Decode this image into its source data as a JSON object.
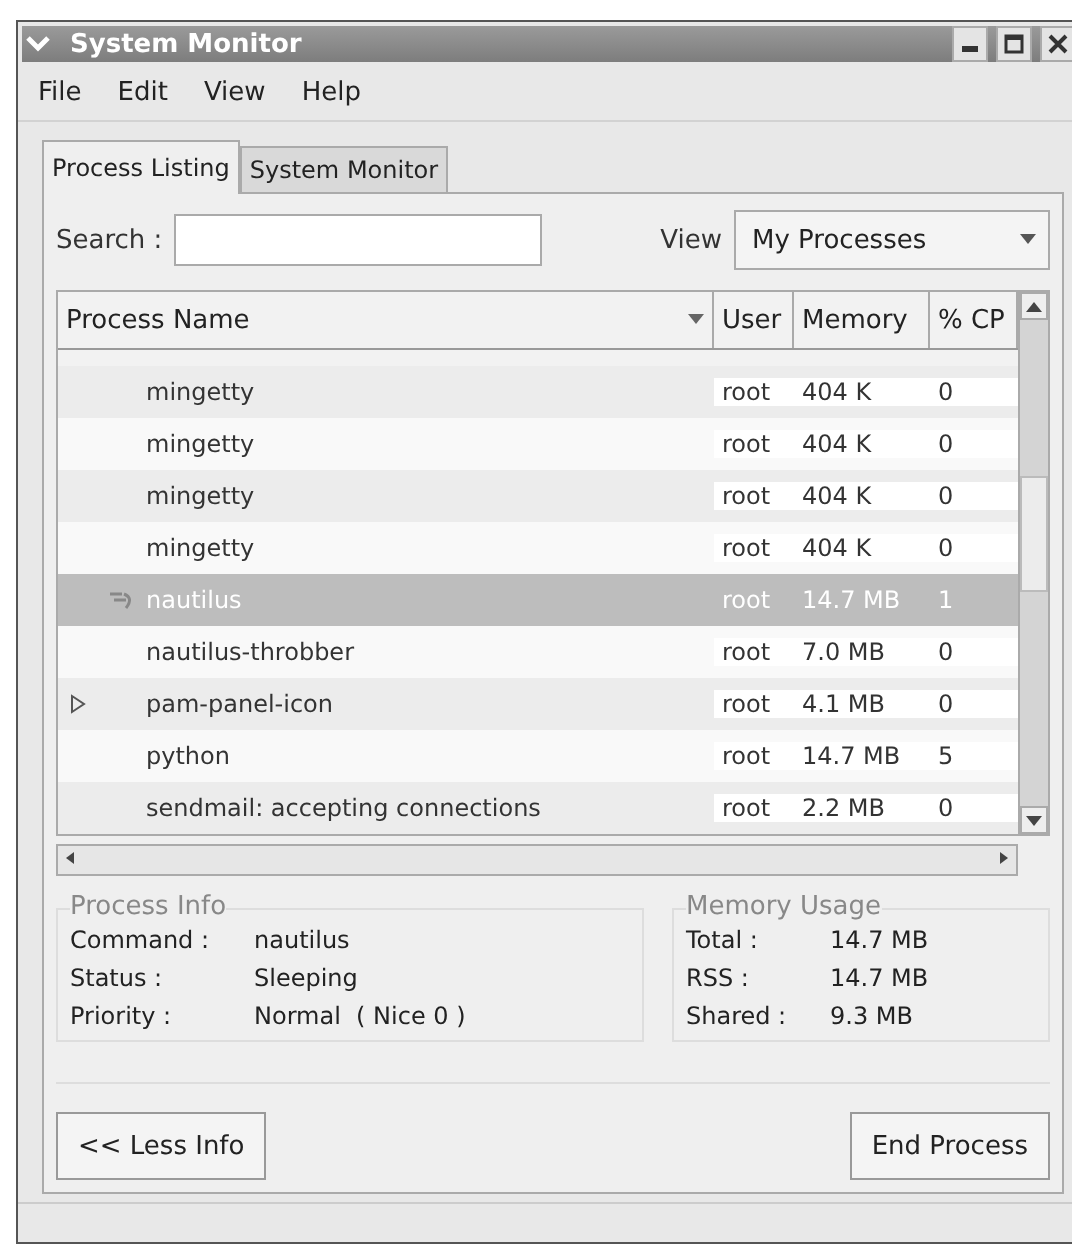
{
  "window": {
    "title": "System Monitor"
  },
  "menu": [
    "File",
    "Edit",
    "View",
    "Help"
  ],
  "tabs": [
    {
      "label": "Process Listing",
      "selected": true
    },
    {
      "label": "System Monitor",
      "selected": false
    }
  ],
  "search": {
    "label": "Search :"
  },
  "view": {
    "label": "View",
    "value": "My Processes"
  },
  "table": {
    "columns": [
      "Process Name",
      "User",
      "Memory",
      "% CP"
    ],
    "rows": [
      {
        "kind": "plain",
        "selected": false,
        "cells": [
          "mingetty",
          "root",
          "404 K",
          "0"
        ]
      },
      {
        "kind": "plain",
        "selected": false,
        "cells": [
          "mingetty",
          "root",
          "404 K",
          "0"
        ]
      },
      {
        "kind": "plain",
        "selected": false,
        "cells": [
          "mingetty",
          "root",
          "404 K",
          "0"
        ]
      },
      {
        "kind": "plain",
        "selected": false,
        "cells": [
          "mingetty",
          "root",
          "404 K",
          "0"
        ]
      },
      {
        "kind": "with-icon",
        "selected": true,
        "cells": [
          "nautilus",
          "root",
          "14.7 MB",
          "1"
        ]
      },
      {
        "kind": "plain",
        "selected": false,
        "cells": [
          "nautilus-throbber",
          "root",
          "7.0 MB",
          "0"
        ]
      },
      {
        "kind": "collapsed",
        "selected": false,
        "cells": [
          "pam-panel-icon",
          "root",
          "4.1 MB",
          "0"
        ]
      },
      {
        "kind": "plain",
        "selected": false,
        "cells": [
          "python",
          "root",
          "14.7 MB",
          "5"
        ]
      },
      {
        "kind": "plain",
        "selected": false,
        "cells": [
          "sendmail: accepting connections",
          "root",
          "2.2 MB",
          "0"
        ]
      }
    ]
  },
  "process_info": {
    "title": "Process Info",
    "fields": [
      {
        "label": "Command :",
        "value": "nautilus"
      },
      {
        "label": "Status :",
        "value": "Sleeping"
      },
      {
        "label": "Priority :",
        "value": "Normal  ( Nice 0 )"
      }
    ]
  },
  "memory_usage": {
    "title": "Memory Usage",
    "fields": [
      {
        "label": "Total :",
        "value": "14.7 MB"
      },
      {
        "label": "RSS :",
        "value": "14.7 MB"
      },
      {
        "label": "Shared :",
        "value": "9.3 MB"
      }
    ]
  },
  "buttons": {
    "left": "<< Less Info",
    "right": "End Process"
  }
}
